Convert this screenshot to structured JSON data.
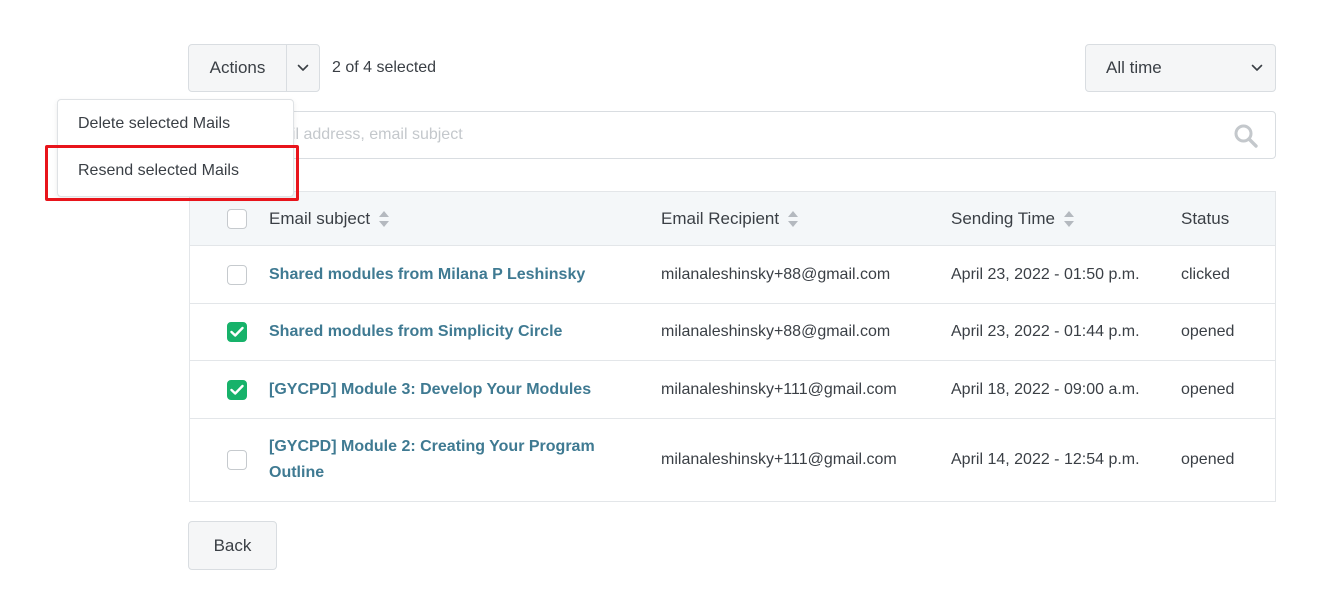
{
  "toolbar": {
    "actions_label": "Actions",
    "selection_status": "2 of 4 selected",
    "time_filter": "All time"
  },
  "search": {
    "placeholder": "ail address, email subject"
  },
  "actions_menu": {
    "items": [
      {
        "label": "Delete selected Mails"
      },
      {
        "label": "Resend selected Mails",
        "highlighted": true
      }
    ],
    "highlight_color": "#e8141b"
  },
  "table": {
    "columns": {
      "subject": "Email subject",
      "recipient": "Email Recipient",
      "sending_time": "Sending Time",
      "status": "Status"
    },
    "rows": [
      {
        "checked": false,
        "subject": "Shared modules from Milana P Leshinsky",
        "recipient": "milanaleshinsky+88@gmail.com",
        "sending_time": "April 23, 2022 - 01:50 p.m.",
        "status": "clicked"
      },
      {
        "checked": true,
        "subject": "Shared modules from Simplicity Circle",
        "recipient": "milanaleshinsky+88@gmail.com",
        "sending_time": "April 23, 2022 - 01:44 p.m.",
        "status": "opened"
      },
      {
        "checked": true,
        "subject": "[GYCPD] Module 3: Develop Your Modules",
        "recipient": "milanaleshinsky+111@gmail.com",
        "sending_time": "April 18, 2022 - 09:00 a.m.",
        "status": "opened"
      },
      {
        "checked": false,
        "subject": "[GYCPD] Module 2: Creating Your Program Outline",
        "recipient": "milanaleshinsky+111@gmail.com",
        "sending_time": "April 14, 2022 - 12:54 p.m.",
        "status": "opened"
      }
    ]
  },
  "footer": {
    "back_label": "Back"
  },
  "colors": {
    "link": "#3f7a92",
    "checkbox_checked": "#17b26a",
    "header_bg": "#f4f7f9"
  }
}
